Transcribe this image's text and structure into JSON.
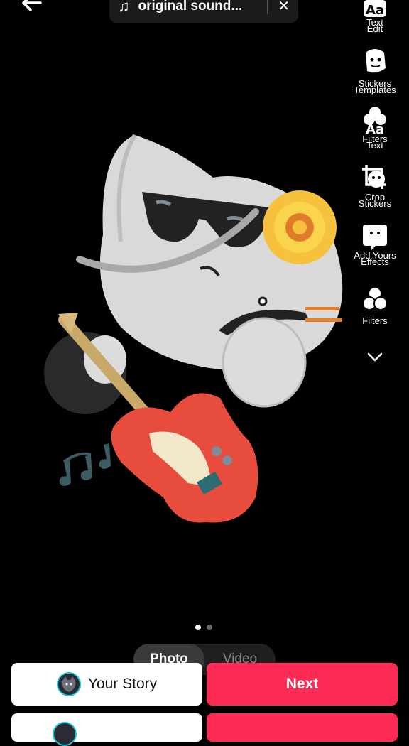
{
  "header": {
    "back_icon": "arrow-left-icon",
    "sound": {
      "icon": "music-note-icon",
      "label": "original sound...",
      "close_icon": "close-icon"
    }
  },
  "toolbar": {
    "items": [
      {
        "icon": "text-icon",
        "label": "Text",
        "label2": "Edit"
      },
      {
        "icon": "stickers-icon",
        "label": "Stickers",
        "label2": "Templates"
      },
      {
        "icon": "filters-icon",
        "label": "Filters",
        "label2": "Text"
      },
      {
        "icon": "crop-icon",
        "label": "Crop",
        "label2": "Stickers"
      },
      {
        "icon": "add-yours-icon",
        "label": "Add Yours",
        "label2": "Effects"
      },
      {
        "icon": "filters-circles-icon",
        "label": "Filters",
        "label2": ""
      },
      {
        "icon": "chevron-down-icon",
        "label": "",
        "label2": ""
      }
    ]
  },
  "mode_switch": {
    "photo": "Photo",
    "video": "Video",
    "selected": "Photo"
  },
  "pagination": {
    "current": 1,
    "total": 2
  },
  "actions": {
    "story_label": "Your Story",
    "next_label": "Next"
  },
  "colors": {
    "accent": "#fe2c55",
    "avatar_ring": "#19c7d6",
    "background": "#000000"
  }
}
